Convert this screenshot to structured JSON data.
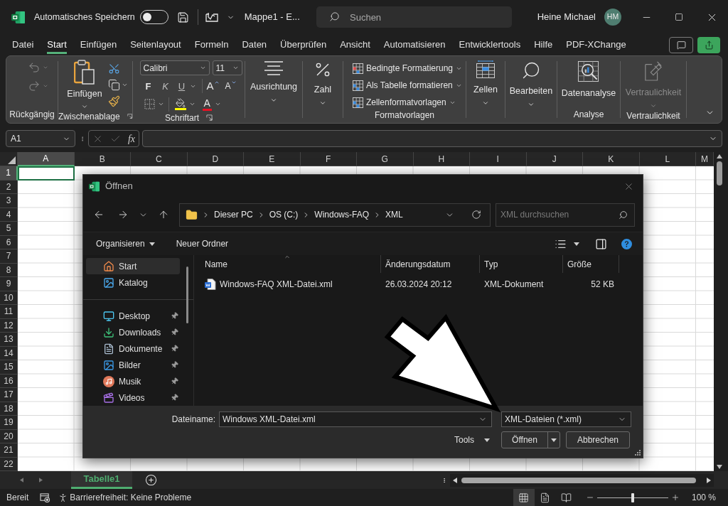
{
  "title_bar": {
    "autosave_label": "Automatisches Speichern",
    "autosave_on": false,
    "document_title": "Mappe1 - E...",
    "search_placeholder": "Suchen",
    "user_name": "Heine Michael",
    "user_initials": "HM"
  },
  "ribbon_tabs": [
    {
      "label": "Datei",
      "selected": false
    },
    {
      "label": "Start",
      "selected": true
    },
    {
      "label": "Einfügen",
      "selected": false
    },
    {
      "label": "Seitenlayout",
      "selected": false
    },
    {
      "label": "Formeln",
      "selected": false
    },
    {
      "label": "Daten",
      "selected": false
    },
    {
      "label": "Überprüfen",
      "selected": false
    },
    {
      "label": "Ansicht",
      "selected": false
    },
    {
      "label": "Automatisieren",
      "selected": false
    },
    {
      "label": "Entwicklertools",
      "selected": false
    },
    {
      "label": "Hilfe",
      "selected": false
    },
    {
      "label": "PDF-XChange",
      "selected": false
    }
  ],
  "ribbon_groups": [
    {
      "kind": "undo",
      "label": "Rückgängig",
      "disabled": true
    },
    {
      "kind": "clipboard",
      "label": "Zwischenablage",
      "button": "Einfügen",
      "disabled": false
    },
    {
      "kind": "font",
      "label": "Schriftart",
      "font_name": "Calibri",
      "font_size": "11",
      "bold": "F",
      "italic": "K",
      "underline": "U",
      "grow": "A",
      "shrink": "A",
      "font_color": "A",
      "disabled": false
    },
    {
      "kind": "alignment",
      "button": "Ausrichtung",
      "disabled": false
    },
    {
      "kind": "number",
      "button": "Zahl",
      "disabled": false
    },
    {
      "kind": "styles",
      "label": "Formatvorlagen",
      "items": [
        "Bedingte Formatierung",
        "Als Tabelle formatieren",
        "Zellenformatvorlagen"
      ],
      "disabled": false
    },
    {
      "kind": "cells",
      "button": "Zellen",
      "disabled": false
    },
    {
      "kind": "editing",
      "button": "Bearbeiten",
      "disabled": false
    },
    {
      "kind": "analysis",
      "label": "Analyse",
      "button": "Datenanalyse",
      "disabled": false
    },
    {
      "kind": "sensitivity",
      "label": "Vertraulichkeit",
      "button": "Vertraulichkeit",
      "disabled": true
    }
  ],
  "formula_bar": {
    "name_box": "A1",
    "function_label": "fx"
  },
  "sheet": {
    "columns": [
      {
        "label": "A",
        "selected": true
      },
      {
        "label": "B",
        "selected": false
      },
      {
        "label": "C",
        "selected": false
      },
      {
        "label": "D",
        "selected": false
      },
      {
        "label": "E",
        "selected": false
      },
      {
        "label": "F",
        "selected": false
      },
      {
        "label": "G",
        "selected": false
      },
      {
        "label": "H",
        "selected": false
      },
      {
        "label": "I",
        "selected": false
      },
      {
        "label": "J",
        "selected": false
      },
      {
        "label": "K",
        "selected": false
      },
      {
        "label": "L",
        "selected": false
      },
      {
        "label": "M",
        "selected": false
      }
    ],
    "rows": [
      {
        "label": "1",
        "selected": true
      },
      {
        "label": "2",
        "selected": false
      },
      {
        "label": "3",
        "selected": false
      },
      {
        "label": "4",
        "selected": false
      },
      {
        "label": "5",
        "selected": false
      },
      {
        "label": "6",
        "selected": false
      },
      {
        "label": "7",
        "selected": false
      },
      {
        "label": "8",
        "selected": false
      },
      {
        "label": "9",
        "selected": false
      },
      {
        "label": "10",
        "selected": false
      },
      {
        "label": "11",
        "selected": false
      },
      {
        "label": "12",
        "selected": false
      },
      {
        "label": "13",
        "selected": false
      },
      {
        "label": "14",
        "selected": false
      },
      {
        "label": "15",
        "selected": false
      },
      {
        "label": "16",
        "selected": false
      },
      {
        "label": "17",
        "selected": false
      },
      {
        "label": "18",
        "selected": false
      },
      {
        "label": "19",
        "selected": false
      },
      {
        "label": "20",
        "selected": false
      },
      {
        "label": "21",
        "selected": false
      },
      {
        "label": "22",
        "selected": false
      }
    ]
  },
  "dialog": {
    "title": "Öffnen",
    "breadcrumb": [
      "Dieser PC",
      "OS (C:)",
      "Windows-FAQ",
      "XML"
    ],
    "search_placeholder": "XML durchsuchen",
    "organize": "Organisieren",
    "new_folder": "Neuer Ordner",
    "nav_sections": [
      {
        "items": [
          {
            "kind": "home",
            "label": "Start",
            "selected": true,
            "pinned": false
          },
          {
            "kind": "gallery",
            "label": "Katalog",
            "selected": false,
            "pinned": false
          }
        ]
      },
      {
        "items": [
          {
            "kind": "desktop",
            "label": "Desktop",
            "selected": false,
            "pinned": true
          },
          {
            "kind": "downloads",
            "label": "Downloads",
            "selected": false,
            "pinned": true
          },
          {
            "kind": "documents",
            "label": "Dokumente",
            "selected": false,
            "pinned": true
          },
          {
            "kind": "pictures",
            "label": "Bilder",
            "selected": false,
            "pinned": true
          },
          {
            "kind": "music",
            "label": "Musik",
            "selected": false,
            "pinned": true
          },
          {
            "kind": "videos",
            "label": "Videos",
            "selected": false,
            "pinned": true
          }
        ]
      }
    ],
    "columns": [
      {
        "label": "Name",
        "sorted": true
      },
      {
        "label": "Änderungsdatum",
        "sorted": false
      },
      {
        "label": "Typ",
        "sorted": false
      },
      {
        "label": "Größe",
        "sorted": false
      }
    ],
    "files": [
      {
        "name": "Windows-FAQ XML-Datei.xml",
        "modified": "26.03.2024 20:12",
        "type": "XML-Dokument",
        "size": "52 KB",
        "selected": false
      }
    ],
    "file_name_label": "Dateiname:",
    "file_name": "Windows XML-Datei.xml",
    "file_type": "XML-Dateien (*.xml)",
    "tools": "Tools",
    "open": "Öffnen",
    "cancel": "Abbrechen"
  },
  "sheet_tabs": [
    {
      "label": "Tabelle1",
      "selected": true
    }
  ],
  "status_bar": {
    "status": "Bereit",
    "accessibility": "Barrierefreiheit: Keine Probleme",
    "views": [
      {
        "kind": "normal",
        "selected": true
      },
      {
        "kind": "layout",
        "selected": false
      },
      {
        "kind": "pagebreak",
        "selected": false
      }
    ],
    "zoom": {
      "level": 0.5,
      "label": "100 %"
    }
  }
}
